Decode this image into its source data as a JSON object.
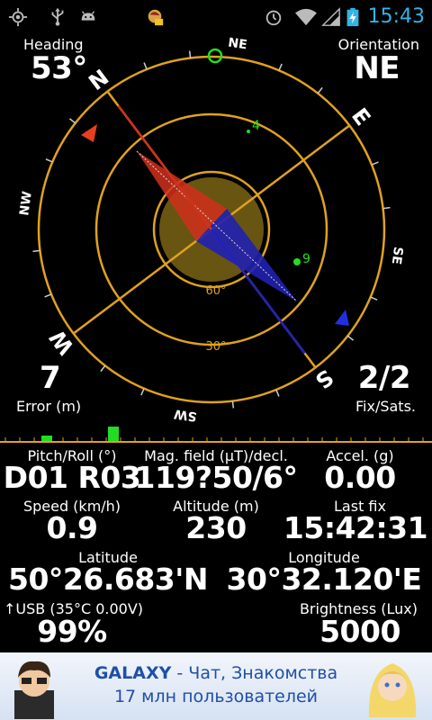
{
  "status_bar": {
    "time": "15:43",
    "icons": [
      "gps-icon",
      "usb-icon",
      "android-icon",
      "notification-app-icon",
      "alarm-icon",
      "wifi-icon",
      "signal-icon",
      "battery-charging-icon"
    ]
  },
  "compass": {
    "heading_label": "Heading",
    "heading_value": "53°",
    "orientation_label": "Orientation",
    "orientation_value": "NE",
    "error_value": "7",
    "error_label": "Error (m)",
    "fix_value": "2/2",
    "fix_label": "Fix/Sats.",
    "cardinals": {
      "N": "N",
      "NE": "NE",
      "E": "E",
      "SE": "SE",
      "S": "S",
      "SW": "SW",
      "W": "W",
      "NW": "NW"
    },
    "elevation_labels": {
      "e60": "60°",
      "e30": "30°"
    },
    "satellites": [
      {
        "id": "4",
        "snr": "weak"
      },
      {
        "id": "9",
        "snr": "strong"
      }
    ],
    "accent_color": "#e0a21c",
    "needle_north_color": "#d0301c",
    "needle_south_color": "#2020b0",
    "satellite_color": "#22dd22"
  },
  "signal_bars": {
    "strengths": [
      0.4,
      1.0
    ]
  },
  "metrics": {
    "pitch_roll_label": "Pitch/Roll (°)",
    "pitch_roll_value": "D01 R03",
    "mag_label": "Mag. field (μT)/decl.",
    "mag_value": "119?50/6°",
    "accel_label": "Accel. (g)",
    "accel_value": "0.00",
    "speed_label": "Speed (km/h)",
    "speed_value": "0.9",
    "altitude_label": "Altitude (m)",
    "altitude_value": "230",
    "lastfix_label": "Last fix",
    "lastfix_value": "15:42:31",
    "latitude_label": "Latitude",
    "latitude_value": "50°26.683'N",
    "longitude_label": "Longitude",
    "longitude_value": "30°32.120'E",
    "usb_label": "↑USB (35°C 0.00V)",
    "usb_value": "99%",
    "brightness_label": "Brightness (Lux)",
    "brightness_value": "5000"
  },
  "ad": {
    "line1_brand": "GALAXY",
    "line1_rest": " - Чат, Знакомства",
    "line2": "17 млн пользователей"
  }
}
